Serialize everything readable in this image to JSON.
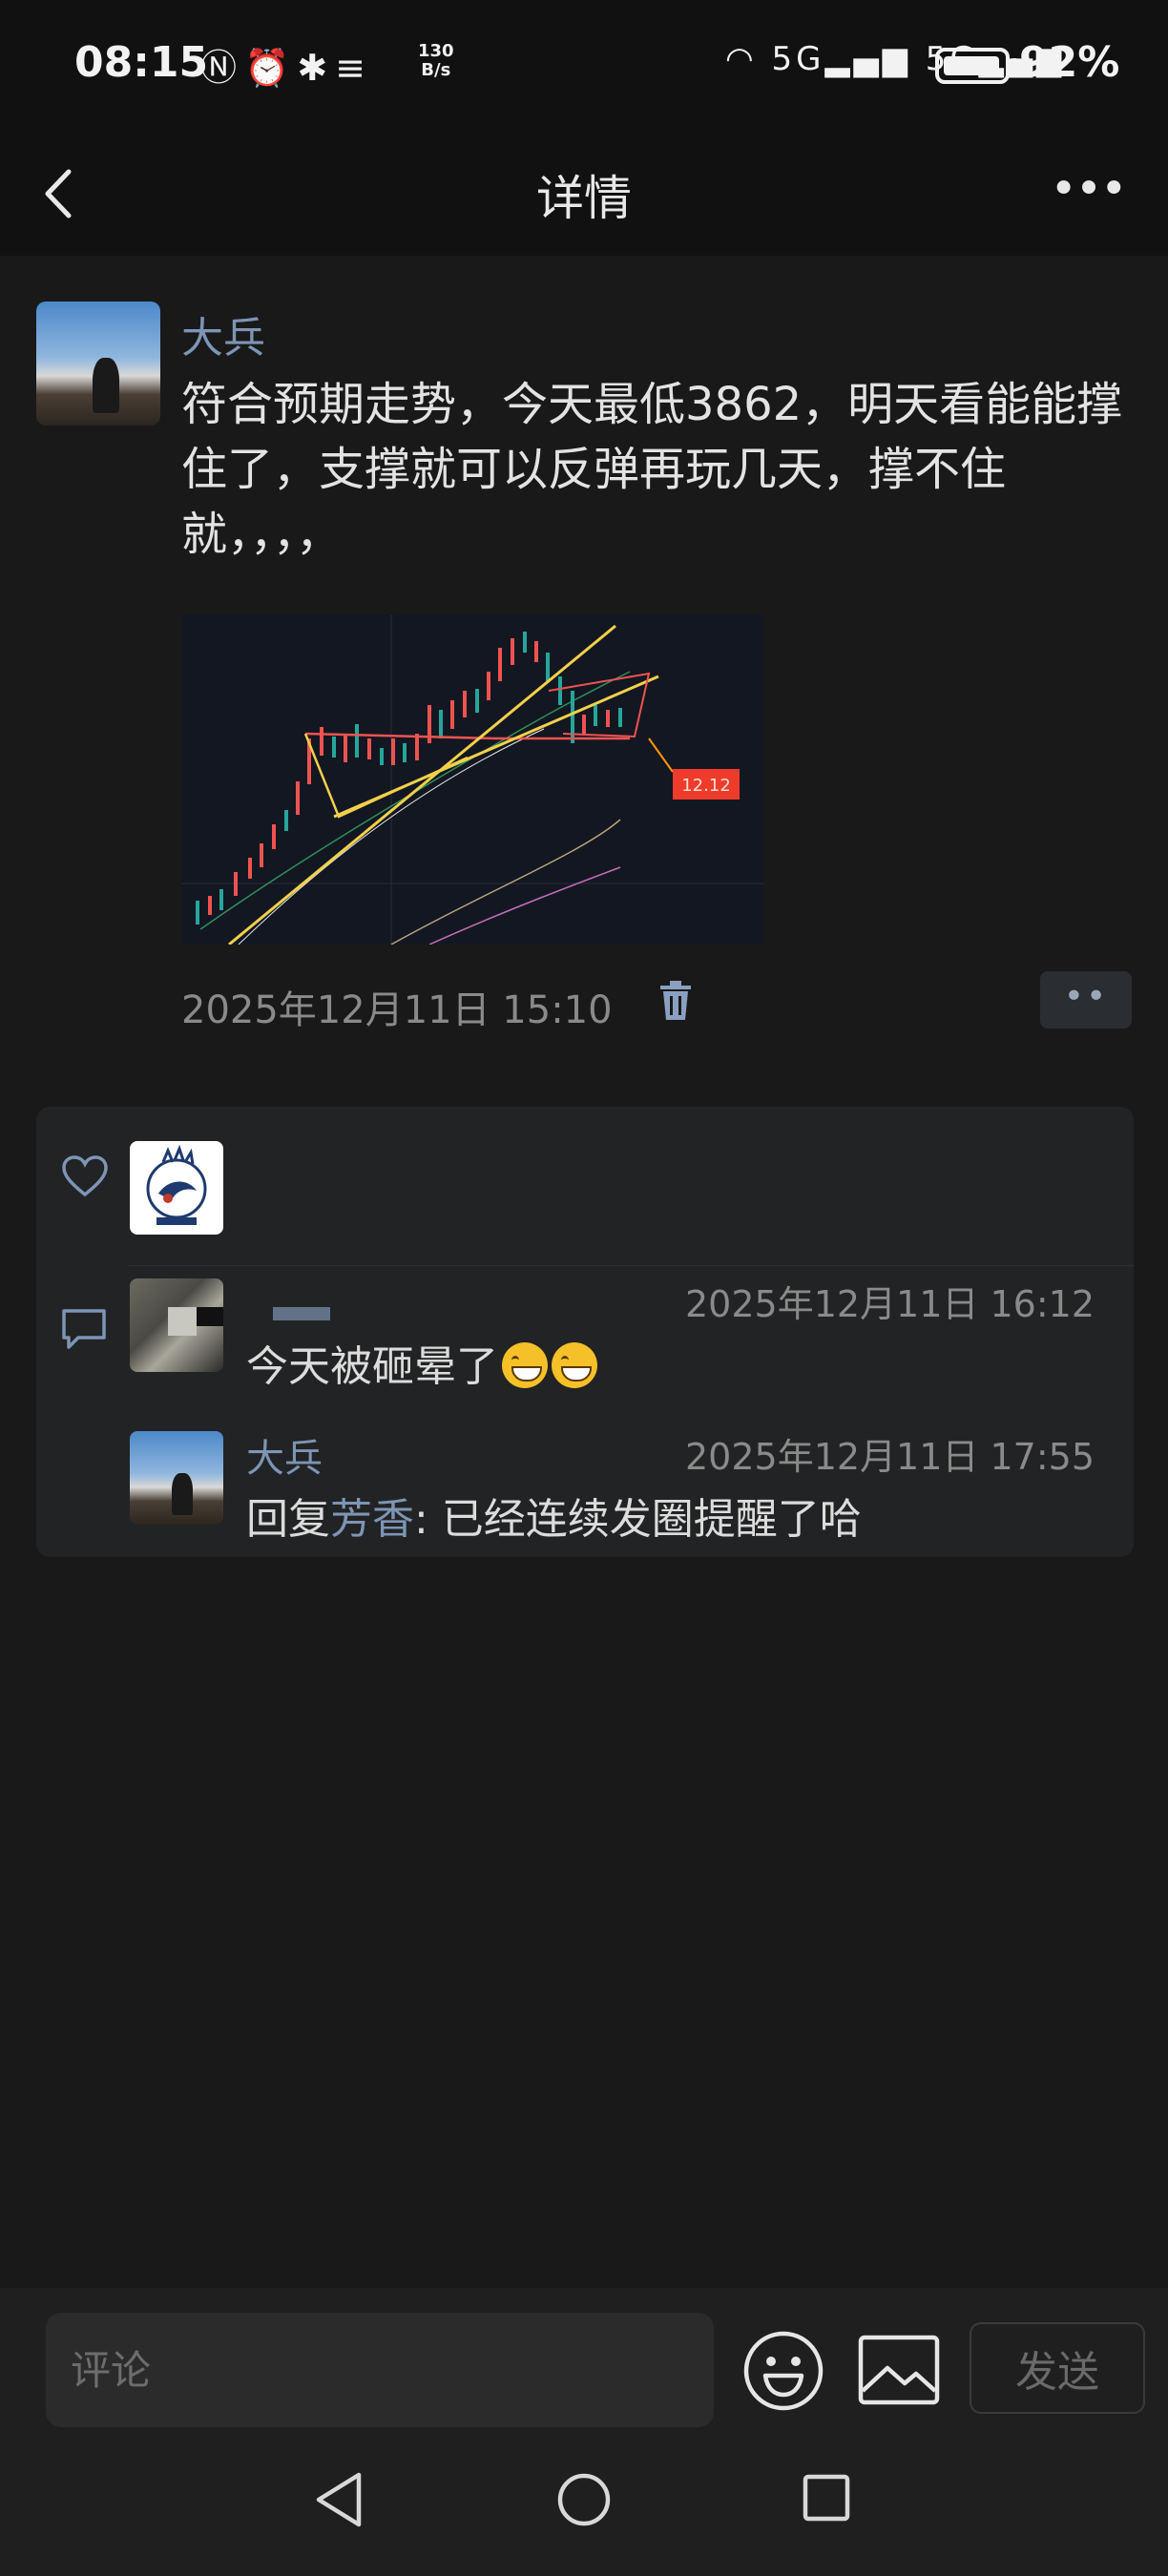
{
  "status_bar": {
    "time": "08:15",
    "left_icons": "Ⓝ⏰✱≡",
    "net_speed_value": "130",
    "net_speed_unit": "B/s",
    "right_icons": "◠ 5G▂▄▆ 5G▂▄▆",
    "battery": "92%"
  },
  "header": {
    "title": "详情",
    "more_label": "•••"
  },
  "post": {
    "author": "大兵",
    "text": "符合预期走势，今天最低3862，明天看能能撑住了，支撑就可以反弹再玩几天，撑不住就，，，，",
    "time": "2025年12月11日 15:10",
    "chart_label": "12.12",
    "actions_label": "••"
  },
  "comments": [
    {
      "name": "",
      "time": "2025年12月11日 16:12",
      "text": "今天被砸晕了"
    },
    {
      "name": "大兵",
      "time": "2025年12月11日 17:55",
      "reply_prefix": "回复",
      "reply_to": "芳香",
      "text": ": 已经连续发圈提醒了哈"
    }
  ],
  "input_bar": {
    "placeholder": "评论",
    "send_label": "发送"
  },
  "colors": {
    "background": "#191919",
    "name_blue": "#7d95b5",
    "panel": "#222324"
  }
}
